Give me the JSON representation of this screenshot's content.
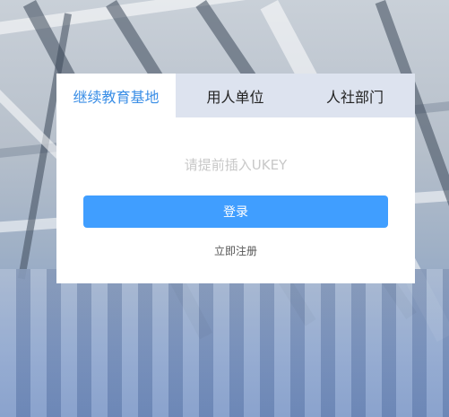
{
  "tabs": [
    {
      "label": "继续教育基地",
      "active": true
    },
    {
      "label": "用人单位",
      "active": false
    },
    {
      "label": "人社部门",
      "active": false
    }
  ],
  "login": {
    "hint": "请提前插入UKEY",
    "submit_label": "登录",
    "register_label": "立即注册"
  },
  "colors": {
    "accent": "#409eff",
    "active_tab_text": "#3a8ee6",
    "tab_bar": "#dde3ef"
  }
}
